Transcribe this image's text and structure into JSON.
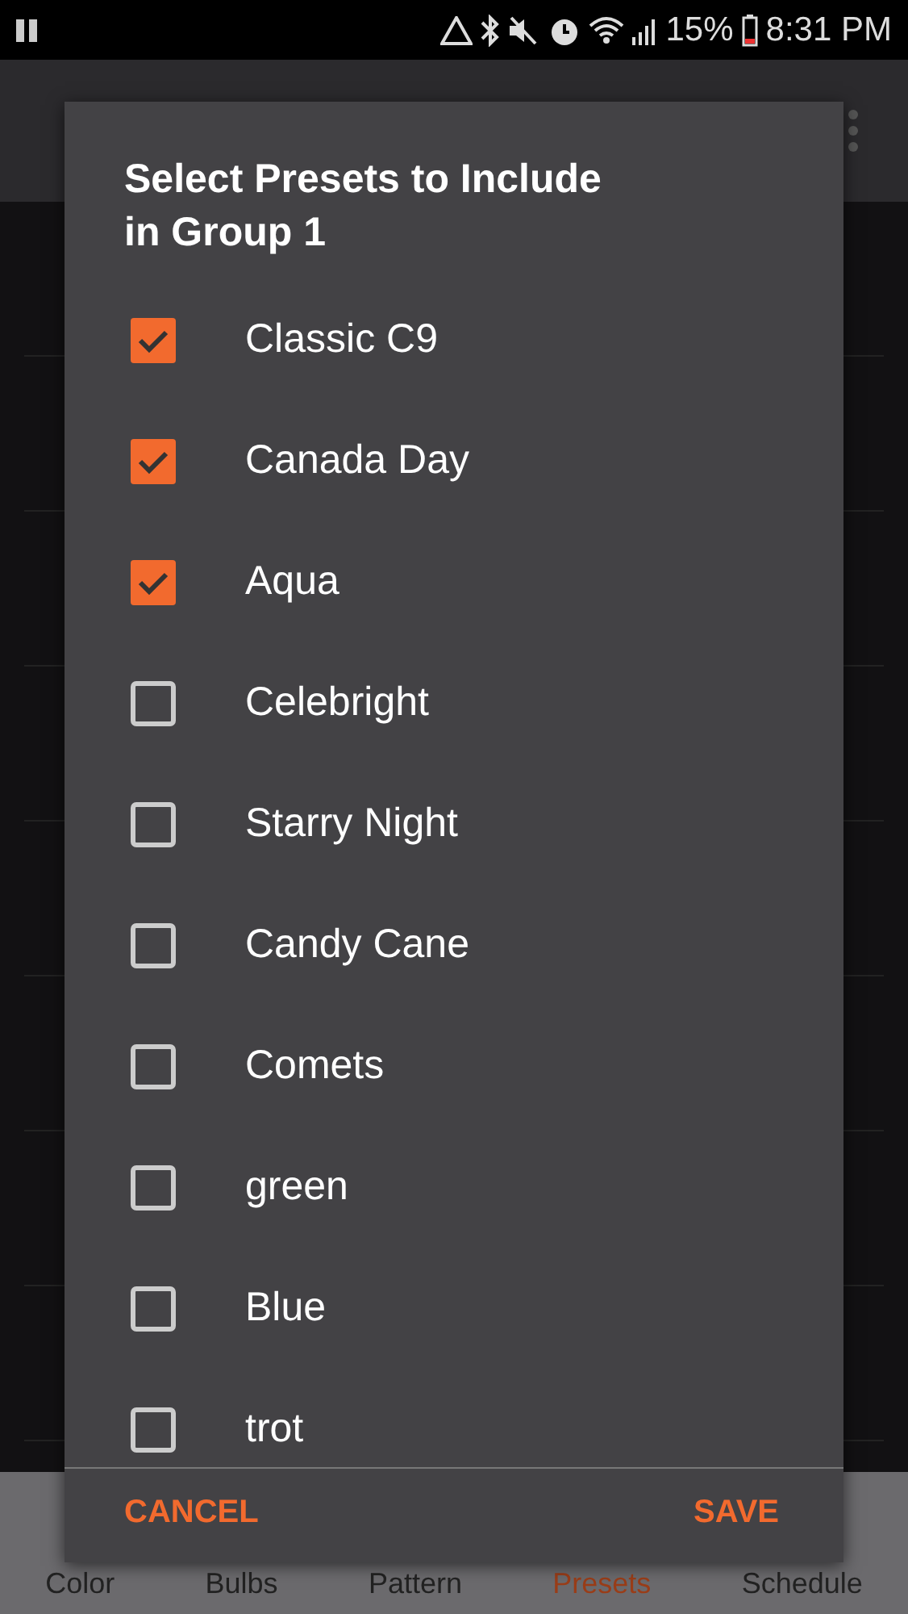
{
  "status_bar": {
    "battery": "15%",
    "time": "8:31 PM"
  },
  "bottom_nav": [
    {
      "label": "Color",
      "selected": false
    },
    {
      "label": "Bulbs",
      "selected": false
    },
    {
      "label": "Pattern",
      "selected": false
    },
    {
      "label": "Presets",
      "selected": true
    },
    {
      "label": "Schedule",
      "selected": false
    }
  ],
  "dialog": {
    "title": "Select Presets to Include in Group 1",
    "items": [
      {
        "label": "Classic C9",
        "checked": true
      },
      {
        "label": "Canada Day",
        "checked": true
      },
      {
        "label": "Aqua",
        "checked": true
      },
      {
        "label": "Celebright",
        "checked": false
      },
      {
        "label": "Starry Night",
        "checked": false
      },
      {
        "label": "Candy Cane",
        "checked": false
      },
      {
        "label": "Comets",
        "checked": false
      },
      {
        "label": "green",
        "checked": false
      },
      {
        "label": "Blue",
        "checked": false
      },
      {
        "label": "trot",
        "checked": false
      }
    ],
    "buttons": [
      "CANCEL",
      "SAVE"
    ]
  }
}
